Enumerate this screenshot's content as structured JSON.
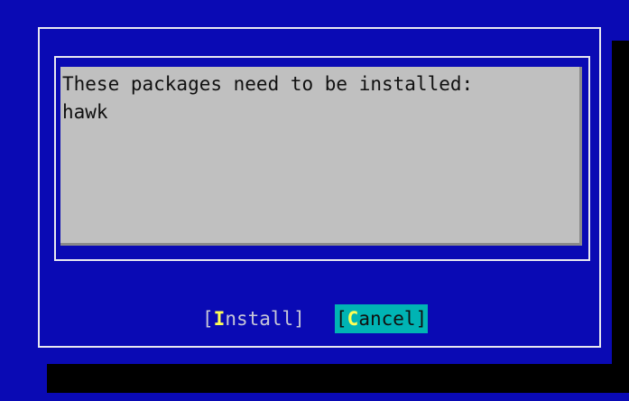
{
  "dialog": {
    "message_line_1": "These packages need to be installed:",
    "message_line_2": "hawk"
  },
  "buttons": {
    "install": {
      "open_bracket": "[",
      "hotkey": "I",
      "rest": "nstall",
      "close_bracket": "]"
    },
    "cancel": {
      "open_bracket": "[",
      "hotkey": "C",
      "rest": "ancel",
      "close_bracket": "]",
      "focused": true
    }
  },
  "colors": {
    "background": "#0a0ab4",
    "text_area": "#c0c0c0",
    "hotkey": "#ffff55",
    "focused_button": "#00b4b4",
    "frame": "#e8e8f0"
  }
}
